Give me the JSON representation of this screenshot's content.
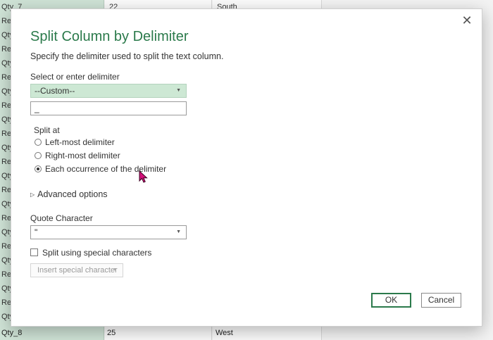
{
  "background_sheet": {
    "column_a_rows": [
      "Qty_7",
      "Rev",
      "Qty",
      "Rev",
      "Qty",
      "Rev",
      "Qty",
      "Rev",
      "Qty",
      "Rev",
      "Qty",
      "Rev",
      "Qty",
      "Rev",
      "Qty",
      "Rev",
      "Qty",
      "Rev",
      "Qty",
      "Rev",
      "Qty",
      "Rev",
      "Qty"
    ],
    "column_b_top": "22",
    "column_c_top": "South",
    "bottom_row": {
      "a": "Qty_8",
      "b": "25",
      "c": "West"
    }
  },
  "dialog": {
    "close_glyph": "✕",
    "title": "Split Column by Delimiter",
    "description": "Specify the delimiter used to split the text column.",
    "delimiter_label": "Select or enter delimiter",
    "delimiter_select_value": "--Custom--",
    "custom_delimiter_value": "_",
    "split_at_label": "Split at",
    "split_options": [
      {
        "label": "Left-most delimiter",
        "selected": false
      },
      {
        "label": "Right-most delimiter",
        "selected": false
      },
      {
        "label": "Each occurrence of the delimiter",
        "selected": true
      }
    ],
    "advanced_options_label": "Advanced options",
    "quote_char_label": "Quote Character",
    "quote_char_value": "\"",
    "special_chars_label": "Split using special characters",
    "special_chars_checked": false,
    "insert_special_label": "Insert special character",
    "ok_label": "OK",
    "cancel_label": "Cancel"
  },
  "colors": {
    "accent_green": "#2b7a4b",
    "select_fill": "#cde8d4",
    "cursor": "#d4107a"
  },
  "icons": {
    "caret": "chevron-down-icon",
    "advanced_toggle": "triangle-right-icon",
    "close": "close-icon",
    "mouse_cursor": "cursor-pointer-icon"
  }
}
